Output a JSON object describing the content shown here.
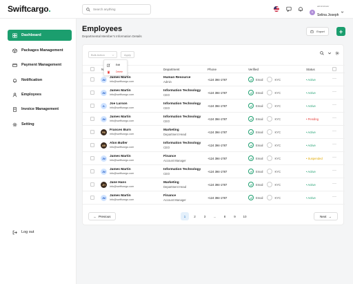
{
  "app": {
    "logo_main": "Swiftcargo",
    "logo_dot": "."
  },
  "search": {
    "placeholder": "Search anything"
  },
  "user": {
    "initial": "S",
    "role": "administrator",
    "name": "Selina Joseph"
  },
  "sidebar": {
    "items": [
      {
        "label": "Dashboard",
        "icon": "dashboard-icon",
        "active": true
      },
      {
        "label": "Packages Management",
        "icon": "package-icon"
      },
      {
        "label": "Payment Management",
        "icon": "card-icon"
      },
      {
        "label": "Notification",
        "icon": "bell-icon"
      },
      {
        "label": "Employees",
        "icon": "user-icon"
      },
      {
        "label": "Invoice Management",
        "icon": "invoice-icon"
      },
      {
        "label": "Setting",
        "icon": "gear-icon"
      }
    ],
    "logout": "Log out"
  },
  "page": {
    "title": "Employees",
    "subtitle": "Departmental Member's Information Details"
  },
  "actions": {
    "export": "Export",
    "add": "+"
  },
  "toolbar": {
    "bulk_action": "Bulk Action",
    "apply": "Apply"
  },
  "bulk_menu": {
    "edit": "Edit",
    "delete": "Delete"
  },
  "table": {
    "headers": {
      "name": "Name",
      "department": "Department",
      "phone": "Phone",
      "verified": "Verified",
      "status": "Status"
    },
    "rows": [
      {
        "initials": "JM",
        "name": "James Martin",
        "email": "info@swiftcargo.com",
        "dept": "Human Resource",
        "position": "Admin",
        "phone": "+124 394-1787",
        "email_label": "Email",
        "kyc_label": "KYC",
        "status": "Active",
        "status_color": "#1b9e6e",
        "photo": false
      },
      {
        "initials": "JM",
        "name": "James Martin",
        "email": "info@swiftcargo.com",
        "dept": "Information Technology",
        "position": "CEO",
        "phone": "+124 394-1787",
        "email_label": "Email",
        "kyc_label": "KYC",
        "status": "Active",
        "status_color": "#1b9e6e",
        "photo": false
      },
      {
        "initials": "JL",
        "name": "Joe Larson",
        "email": "info@swiftcargo.com",
        "dept": "Information Technology",
        "position": "CEO",
        "phone": "+124 394-1787",
        "email_label": "Email",
        "kyc_label": "KYC",
        "status": "Active",
        "status_color": "#1b9e6e",
        "photo": false
      },
      {
        "initials": "JM",
        "name": "James Martin",
        "email": "info@swiftcargo.com",
        "dept": "Information Technology",
        "position": "CEO",
        "phone": "+124 394-1787",
        "email_label": "Email",
        "kyc_label": "KYC",
        "status": "Pending",
        "status_color": "#e53935",
        "photo": false
      },
      {
        "initials": "FB",
        "name": "Frances Burn",
        "email": "info@swiftcargo.com",
        "dept": "Marketing",
        "position": "Department Head",
        "phone": "+124 394-1787",
        "email_label": "Email",
        "kyc_label": "KYC",
        "status": "Active",
        "status_color": "#1b9e6e",
        "photo": true
      },
      {
        "initials": "AB",
        "name": "Alon Butler",
        "email": "info@swiftcargo.com",
        "dept": "Information Technology",
        "position": "CEO",
        "phone": "+124 394-1787",
        "email_label": "Email",
        "kyc_label": "KYC",
        "status": "Active",
        "status_color": "#1b9e6e",
        "photo": true
      },
      {
        "initials": "JM",
        "name": "James Martin",
        "email": "info@swiftcargo.com",
        "dept": "Finance",
        "position": "Account Manager",
        "phone": "+124 394-1787",
        "email_label": "Email",
        "kyc_label": "KYC",
        "status": "Suspended",
        "status_color": "#e0a800",
        "photo": false
      },
      {
        "initials": "JM",
        "name": "James Martin",
        "email": "info@swiftcargo.com",
        "dept": "Information Technology",
        "position": "CEO",
        "phone": "+124 394-1787",
        "email_label": "Email",
        "kyc_label": "KYC",
        "status": "Active",
        "status_color": "#1b9e6e",
        "photo": false
      },
      {
        "initials": "JH",
        "name": "Jane Hans",
        "email": "info@swiftcargo.com",
        "dept": "Marketing",
        "position": "Department Head",
        "phone": "+124 394-1787",
        "email_label": "Email",
        "kyc_label": "KYC",
        "status": "Active",
        "status_color": "#1b9e6e",
        "photo": true
      },
      {
        "initials": "JM",
        "name": "James Martin",
        "email": "info@swiftcargo.com",
        "dept": "Finance",
        "position": "Account Manager",
        "phone": "+124 394-1787",
        "email_label": "Email",
        "kyc_label": "KYC",
        "status": "Active",
        "status_color": "#1b9e6e",
        "photo": false
      }
    ]
  },
  "pagination": {
    "previous": "Previous",
    "next": "Next",
    "pages": [
      "1",
      "2",
      "3",
      "...",
      "8",
      "9",
      "10"
    ],
    "current": "1"
  },
  "colors": {
    "accent": "#1b9e6e",
    "pending": "#e53935",
    "suspended": "#e0a800"
  }
}
